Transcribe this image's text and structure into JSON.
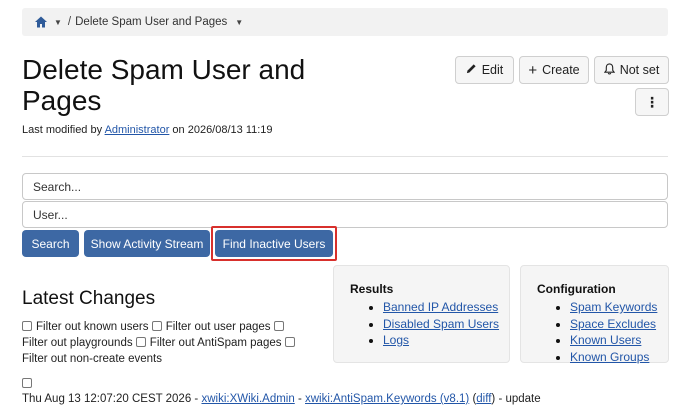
{
  "breadcrumb": {
    "separator": "/",
    "current": "Delete Spam User and Pages"
  },
  "page": {
    "title": "Delete Spam User and Pages",
    "modified_prefix": "Last modified by",
    "modified_user": "Administrator",
    "modified_on": "on 2026/08/13 11:19"
  },
  "actions": {
    "edit": "Edit",
    "create": "Create",
    "notset": "Not set",
    "more_icon": "⋮"
  },
  "search": {
    "placeholder": "Search...",
    "user_placeholder": "User..."
  },
  "buttons": {
    "search": "Search",
    "activity": "Show Activity Stream",
    "inactive": "Find Inactive Users"
  },
  "latest": {
    "heading": "Latest Changes",
    "filters": [
      "Filter out known users",
      "Filter out user pages",
      "Filter out playgrounds",
      "Filter out AntiSpam pages",
      "Filter out non-create events"
    ]
  },
  "results": {
    "title": "Results",
    "links": [
      "Banned IP Addresses",
      "Disabled Spam Users",
      "Logs"
    ]
  },
  "config": {
    "title": "Configuration",
    "links": [
      "Spam Keywords",
      "Space Excludes",
      "Known Users",
      "Known Groups"
    ]
  },
  "change": {
    "date": "Thu Aug 13 12:07:20 CEST 2026",
    "sep1": " - ",
    "user": "xwiki:XWiki.Admin",
    "sep2": " - ",
    "page": "xwiki:AntiSpam.Keywords (v8.1)",
    "diff_open": " (",
    "diff": "diff",
    "diff_close": ") - update"
  },
  "colors": {
    "primary": "#3d68a4",
    "highlight": "#d8302c",
    "link": "#2256a8"
  }
}
